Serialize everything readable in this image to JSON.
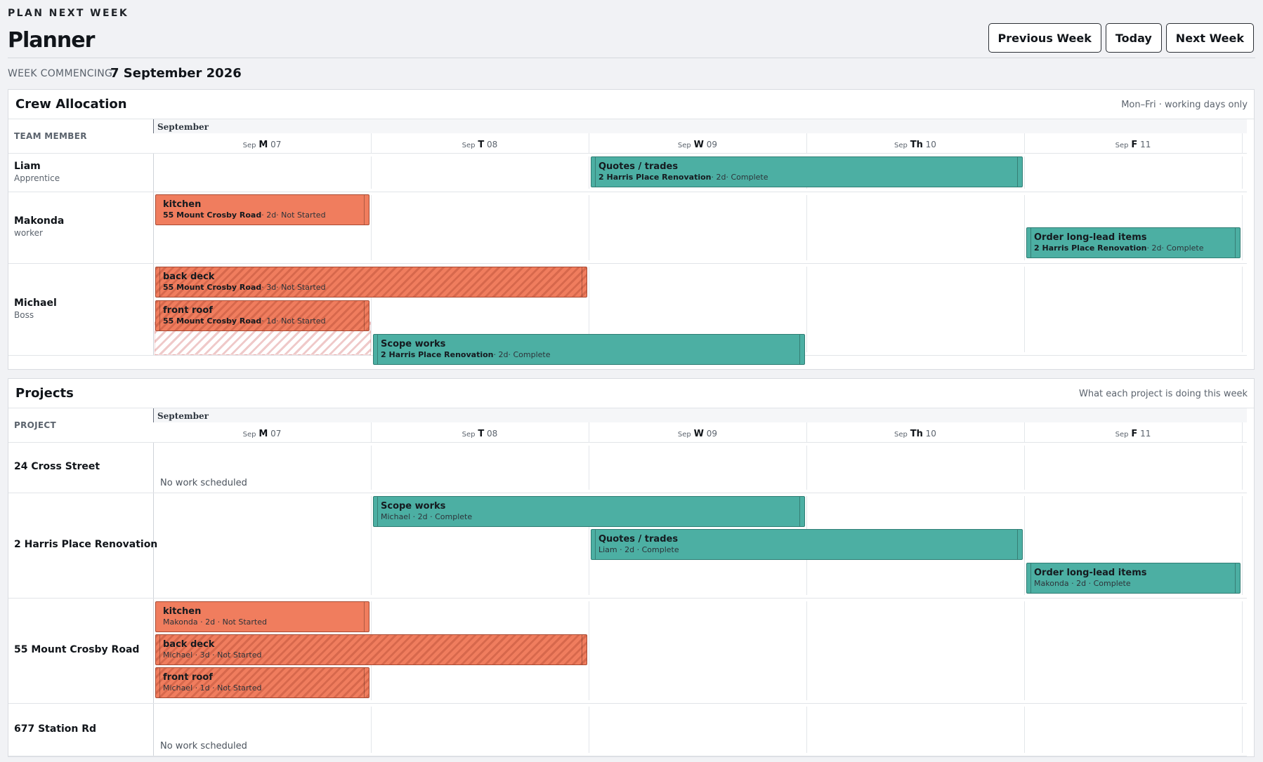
{
  "header": {
    "eyebrow": "PLAN NEXT WEEK",
    "title": "Planner",
    "buttons": {
      "previous": "Previous Week",
      "today": "Today",
      "next": "Next Week"
    },
    "week_label": "WEEK COMMENCING",
    "week_date": "7 September 2026"
  },
  "days": [
    {
      "mo": "Sep",
      "wd": "M",
      "num": "07"
    },
    {
      "mo": "Sep",
      "wd": "T",
      "num": "08"
    },
    {
      "mo": "Sep",
      "wd": "W",
      "num": "09"
    },
    {
      "mo": "Sep",
      "wd": "Th",
      "num": "10"
    },
    {
      "mo": "Sep",
      "wd": "F",
      "num": "11"
    }
  ],
  "month": "September",
  "crew": {
    "title": "Crew Allocation",
    "note": "Mon–Fri · working days only",
    "column_label": "TEAM MEMBER",
    "rows": [
      {
        "name": "Liam",
        "role": "Apprentice"
      },
      {
        "name": "Makonda",
        "role": "worker"
      },
      {
        "name": "Michael",
        "role": "Boss"
      }
    ],
    "bars": [
      {
        "task": "Quotes / trades",
        "project": "2 Harris Place Renovation",
        "meta": "· 2d· Complete",
        "color": "teal",
        "hatch": false
      },
      {
        "task": "kitchen",
        "project": "55 Mount Crosby Road",
        "meta": "· 2d· Not Started",
        "color": "orange",
        "hatch": false
      },
      {
        "task": "Order long-lead items",
        "project": "2 Harris Place Renovation",
        "meta": "· 2d· Complete",
        "color": "teal",
        "hatch": false
      },
      {
        "task": "back deck",
        "project": "55 Mount Crosby Road",
        "meta": "· 3d· Not Started",
        "color": "orange",
        "hatch": true
      },
      {
        "task": "front roof",
        "project": "55 Mount Crosby Road",
        "meta": "· 1d· Not Started",
        "color": "orange",
        "hatch": true
      },
      {
        "task": "Scope works",
        "project": "2 Harris Place Renovation",
        "meta": "· 2d· Complete",
        "color": "teal",
        "hatch": false
      }
    ]
  },
  "projects": {
    "title": "Projects",
    "note": "What each project is doing this week",
    "column_label": "PROJECT",
    "empty_text": "No work scheduled",
    "rows": [
      {
        "name": "24 Cross Street"
      },
      {
        "name": "2 Harris Place Renovation"
      },
      {
        "name": "55 Mount Crosby Road"
      },
      {
        "name": "677 Station Rd"
      }
    ],
    "bars": [
      {
        "task": "Scope works",
        "meta": "Michael · 2d · Complete",
        "color": "teal",
        "hatch": false
      },
      {
        "task": "Quotes / trades",
        "meta": "Liam · 2d · Complete",
        "color": "teal",
        "hatch": false
      },
      {
        "task": "Order long-lead items",
        "meta": "Makonda · 2d · Complete",
        "color": "teal",
        "hatch": false
      },
      {
        "task": "kitchen",
        "meta": "Makonda · 2d · Not Started",
        "color": "orange",
        "hatch": false
      },
      {
        "task": "back deck",
        "meta": "Michael · 3d · Not Started",
        "color": "orange",
        "hatch": true
      },
      {
        "task": "front roof",
        "meta": "Michael · 1d · Not Started",
        "color": "orange",
        "hatch": true
      }
    ]
  },
  "colors": {
    "teal": "#4cafa3",
    "orange": "#f07d5e",
    "background": "#f1f2f5"
  }
}
